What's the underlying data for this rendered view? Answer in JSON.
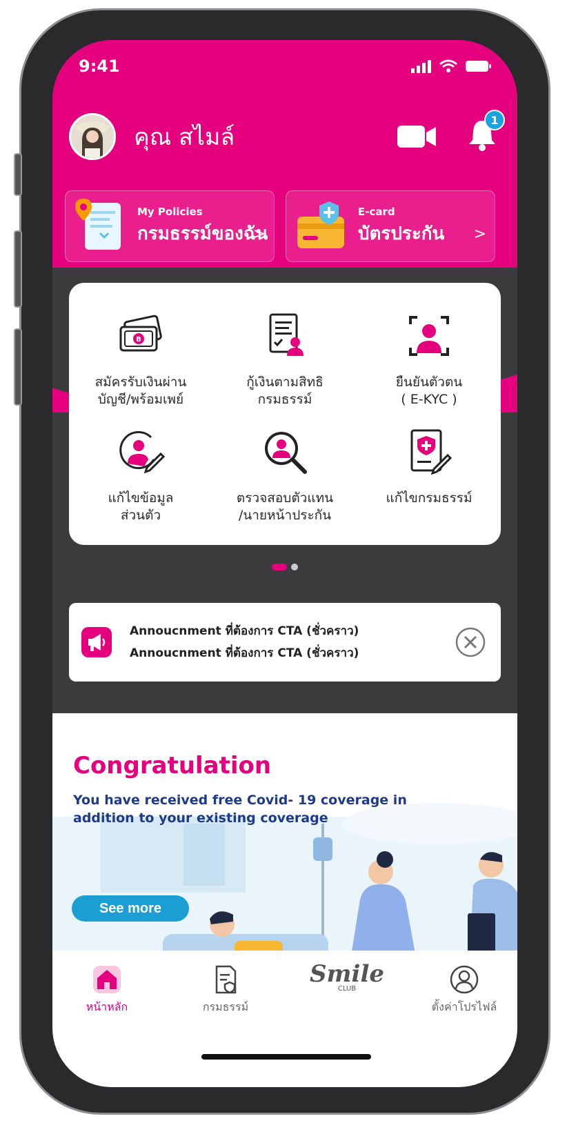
{
  "status_bar": {
    "time": "9:41"
  },
  "header": {
    "user_name": "คุณ สไมล์",
    "notification_count": "1"
  },
  "cards": [
    {
      "subtitle": "My Policies",
      "title": "กรมธรรม์ของฉัน",
      "chevron": ">"
    },
    {
      "subtitle": "E-card",
      "title": "บัตรประกัน",
      "chevron": ">"
    }
  ],
  "menu": [
    {
      "line1": "สมัครรับเงินผ่าน",
      "line2": "บัญชี/พร้อมเพย์",
      "icon": "banknote-icon"
    },
    {
      "line1": "กู้เงินตามสิทธิ",
      "line2": "กรมธรรม์",
      "icon": "document-person-icon"
    },
    {
      "line1": "ยืนยันตัวตน",
      "line2": "( E-KYC )",
      "icon": "face-scan-icon"
    },
    {
      "line1": "แก้ไขข้อมูล",
      "line2": "ส่วนตัว",
      "icon": "edit-profile-icon"
    },
    {
      "line1": "ตรวจสอบตัวแทน",
      "line2": "/นายหน้าประกัน",
      "icon": "search-agent-icon"
    },
    {
      "line1": "แก้ไขกรมธรรม์",
      "line2": "",
      "icon": "edit-policy-icon"
    }
  ],
  "pagination": {
    "current": 1,
    "total": 2
  },
  "announcement": {
    "line1": "Annoucnment ที่ต้องการ CTA (ชั่วคราว)",
    "line2": "Annoucnment ที่ต้องการ CTA (ชั่วคราว)"
  },
  "promo": {
    "title": "Congratulation",
    "subtitle": "You have received free Covid- 19 coverage in addition to your existing coverage",
    "button": "See more"
  },
  "tabs": [
    {
      "label": "หน้าหลัก",
      "icon": "home-icon",
      "active": true
    },
    {
      "label": "กรมธรรม์",
      "icon": "policy-document-icon",
      "active": false
    },
    {
      "label": "Smile",
      "sub": "CLUB",
      "icon": "smile-club-logo",
      "active": false
    },
    {
      "label": "ตั้งค่าโปรไฟล์",
      "icon": "profile-icon",
      "active": false
    }
  ],
  "colors": {
    "brand": "#e5007e",
    "accent_blue": "#1b9fd3",
    "dark_bg": "#3b3b3d",
    "text_navy": "#1e3a8a"
  }
}
